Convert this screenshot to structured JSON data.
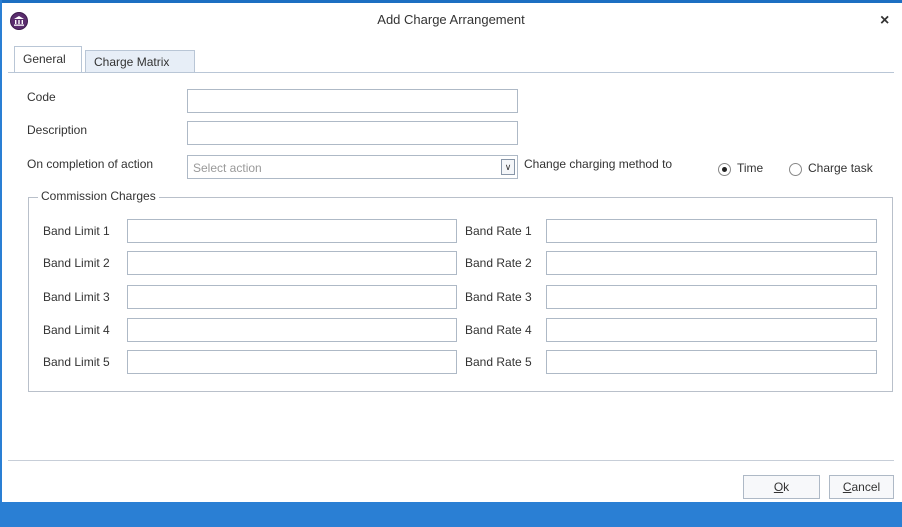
{
  "window": {
    "title": "Add Charge Arrangement",
    "app_icon": "institution-icon",
    "close_glyph": "×"
  },
  "tabs": [
    {
      "label": "General",
      "active": true
    },
    {
      "label": "Charge Matrix",
      "active": false
    }
  ],
  "form": {
    "code_label": "Code",
    "code_value": "",
    "description_label": "Description",
    "description_value": "",
    "completion_label": "On completion of action",
    "completion_placeholder": "Select action",
    "change_method_label": "Change charging method to",
    "radio_time_label": "Time",
    "radio_charge_task_label": "Charge task",
    "selected_method": "Time"
  },
  "commission": {
    "title": "Commission Charges",
    "band_limits": [
      {
        "label": "Band Limit 1",
        "value": ""
      },
      {
        "label": "Band Limit 2",
        "value": ""
      },
      {
        "label": "Band Limit 3",
        "value": ""
      },
      {
        "label": "Band Limit 4",
        "value": ""
      },
      {
        "label": "Band Limit 5",
        "value": ""
      }
    ],
    "band_rates": [
      {
        "label": "Band Rate 1",
        "value": ""
      },
      {
        "label": "Band Rate 2",
        "value": ""
      },
      {
        "label": "Band Rate 3",
        "value": ""
      },
      {
        "label": "Band Rate 4",
        "value": ""
      },
      {
        "label": "Band Rate 5",
        "value": ""
      }
    ]
  },
  "buttons": {
    "ok_mnemonic": "O",
    "ok_rest": "k",
    "cancel_mnemonic": "C",
    "cancel_rest": "ancel"
  },
  "colors": {
    "accent": "#2a7fd4",
    "icon": "#5a2d6e"
  }
}
